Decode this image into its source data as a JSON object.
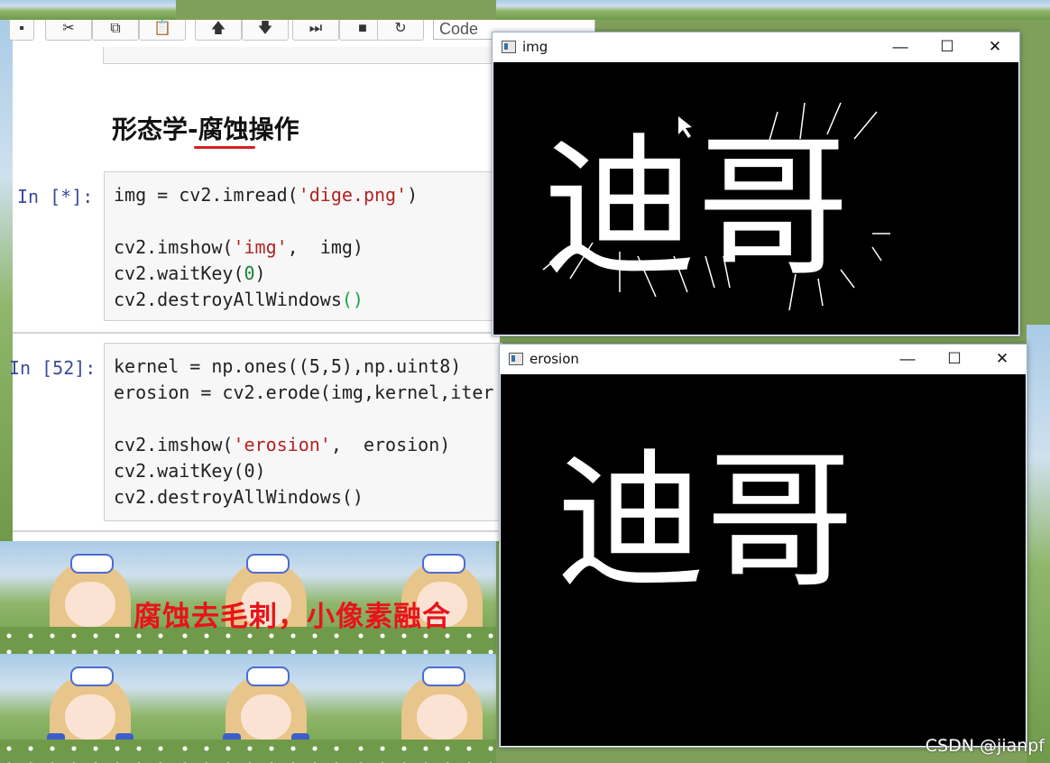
{
  "toolbar": {
    "cut_icon": "scissors-icon",
    "copy_icon": "copy-icon",
    "paste_icon": "paste-icon",
    "up_icon": "arrow-up-icon",
    "down_icon": "arrow-down-icon",
    "run_icon": "run-next-icon",
    "stop_icon": "stop-icon",
    "restart_icon": "restart-icon",
    "cell_type": "Code",
    "keyboard_icon": "keyboard-icon"
  },
  "notebook": {
    "heading_prefix": "形态学-",
    "heading_highlight": "腐蚀",
    "heading_suffix": "操作",
    "cell1": {
      "prompt": "In [*]:",
      "lines": {
        "l1a": "img = cv2.imread(",
        "l1s": "'dige.png'",
        "l1b": ")",
        "l2a": "cv2.imshow(",
        "l2s": "'img'",
        "l2b": ",  img)",
        "l3a": "cv2.waitKey(",
        "l3n": "0",
        "l3b": ")",
        "l4a": "cv2.destroyAllWindows",
        "l4p": "()"
      }
    },
    "cell2": {
      "prompt": "In [52]:",
      "lines": {
        "l1": "kernel = np.ones((5,5),np.uint8)",
        "l2": "erosion = cv2.erode(img,kernel,iter",
        "l3a": "cv2.imshow(",
        "l3s": "'erosion'",
        "l3b": ",  erosion)",
        "l4": "cv2.waitKey(0)",
        "l5": "cv2.destroyAllWindows()"
      }
    }
  },
  "caption": "腐蚀去毛刺，小像素融合",
  "windows": {
    "img": {
      "title": "img",
      "minimize": "—",
      "maximize": "☐",
      "close": "✕",
      "text": "迪哥"
    },
    "erosion": {
      "title": "erosion",
      "minimize": "—",
      "maximize": "☐",
      "close": "✕",
      "text": "迪哥"
    }
  },
  "watermark": "CSDN @jianpf"
}
